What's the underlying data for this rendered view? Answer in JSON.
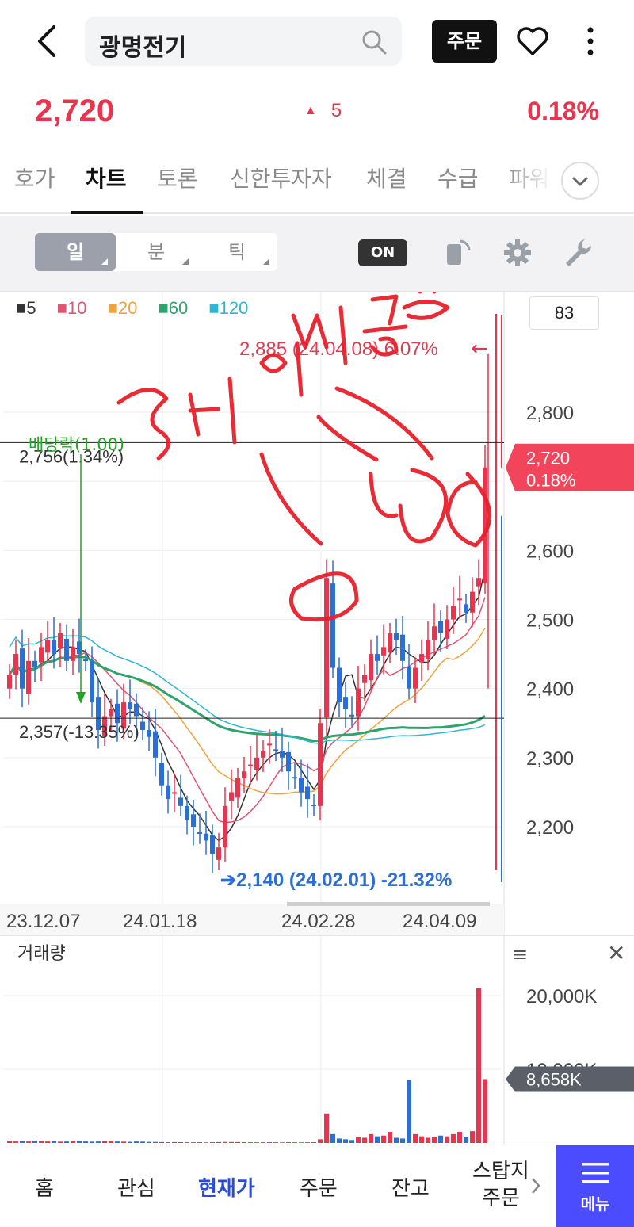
{
  "header": {
    "stock_name": "광명전기",
    "order_label": "주문"
  },
  "price": {
    "current": "2,720",
    "change": "5",
    "rate": "0.18%",
    "up_color": "#e8344e",
    "down_color": "#2b6fd6"
  },
  "tabs": [
    {
      "label": "호가"
    },
    {
      "label": "차트",
      "active": true
    },
    {
      "label": "토론"
    },
    {
      "label": "신한투자자"
    },
    {
      "label": "체결"
    },
    {
      "label": "수급"
    },
    {
      "label": "파워"
    }
  ],
  "toolbar": {
    "periods": [
      {
        "label": "일",
        "active": true
      },
      {
        "label": "분"
      },
      {
        "label": "틱"
      }
    ],
    "toggle_label": "ON"
  },
  "legend": [
    {
      "label": "5",
      "color": "#333333"
    },
    {
      "label": "10",
      "color": "#e05470"
    },
    {
      "label": "20",
      "color": "#f0a23c"
    },
    {
      "label": "60",
      "color": "#2ea36b"
    },
    {
      "label": "120",
      "color": "#2fb6d4"
    }
  ],
  "chart_data": [
    {
      "type": "candlestick",
      "legend": [
        "5",
        "10",
        "20",
        "60",
        "120"
      ],
      "y_box": "83",
      "y_ticks": [
        "2,800",
        "2,700",
        "2,600",
        "2,500",
        "2,400",
        "2,300",
        "2,200"
      ],
      "ylim": [
        2130,
        2900
      ],
      "x_ticks": [
        "23.12.07",
        "24.01.18",
        "24.02.28",
        "24.04.09"
      ],
      "current_tag": {
        "price": "2,720",
        "rate": "0.18%"
      },
      "high_annotation": "2,885 (24.04.08) 6.07%",
      "low_annotation": "2,140 (24.02.01) -21.32%",
      "ref_lines": [
        {
          "label": "2,756(1.34%)",
          "value": 2756
        },
        {
          "label": "2,357(-13.35%)",
          "value": 2357
        }
      ],
      "dividend_label": "배당락(1.00)",
      "closes": [
        2420,
        2450,
        2400,
        2440,
        2430,
        2460,
        2470,
        2450,
        2480,
        2440,
        2460,
        2450,
        2440,
        2380,
        2340,
        2360,
        2370,
        2350,
        2380,
        2370,
        2360,
        2340,
        2330,
        2300,
        2260,
        2240,
        2250,
        2230,
        2210,
        2200,
        2190,
        2180,
        2160,
        2170,
        2230,
        2250,
        2270,
        2280,
        2290,
        2300,
        2310,
        2320,
        2310,
        2300,
        2280,
        2270,
        2250,
        2240,
        2230,
        2350,
        2560,
        2430,
        2380,
        2370,
        2360,
        2400,
        2420,
        2450,
        2440,
        2460,
        2480,
        2470,
        2440,
        2400,
        2430,
        2450,
        2470,
        2490,
        2480,
        2500,
        2520,
        2530,
        2510,
        2540,
        2560,
        2720
      ],
      "candle_highs_note": "approximate; marks drawn from closes",
      "volume": {
        "title": "거래량",
        "y_ticks": [
          "20,000K",
          "10,000K"
        ],
        "current_tag": "8,658K",
        "values_k": [
          300,
          200,
          250,
          200,
          300,
          250,
          200,
          220,
          180,
          200,
          250,
          220,
          200,
          180,
          200,
          220,
          250,
          200,
          180,
          160,
          200,
          180,
          150,
          140,
          120,
          100,
          120,
          110,
          100,
          90,
          100,
          80,
          100,
          120,
          140,
          130,
          120,
          110,
          100,
          90,
          100,
          110,
          90,
          80,
          100,
          90,
          80,
          90,
          100,
          500,
          4000,
          1200,
          600,
          500,
          400,
          800,
          700,
          1200,
          900,
          1000,
          1500,
          700,
          600,
          8500,
          1200,
          900,
          700,
          800,
          1000,
          900,
          1200,
          1500,
          800,
          1600,
          21000,
          8658
        ]
      }
    }
  ],
  "annotation": {
    "handwriting_text": "3번의 매집봉"
  },
  "bottom_nav": [
    {
      "label": "홈"
    },
    {
      "label": "관심"
    },
    {
      "label": "현재가",
      "active": true
    },
    {
      "label": "주문"
    },
    {
      "label": "잔고"
    },
    {
      "label": "스탑지"
    },
    {
      "label": "주문"
    }
  ],
  "menu_label": "메뉴"
}
